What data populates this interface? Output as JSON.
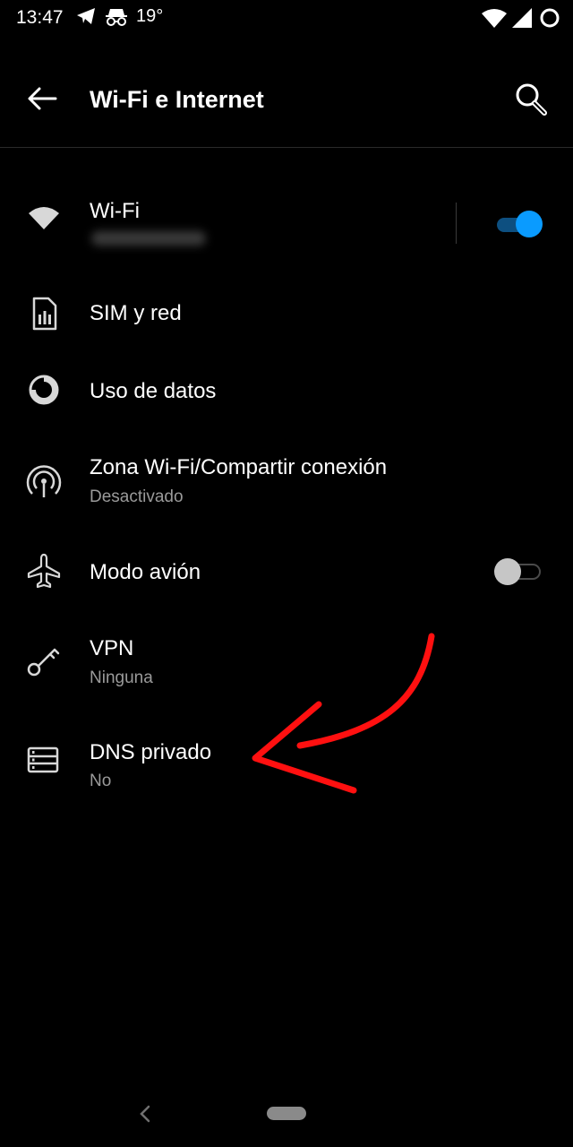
{
  "status_bar": {
    "time": "13:47",
    "temperature": "19°",
    "icons": [
      "telegram-icon",
      "incognito-icon",
      "wifi-icon",
      "signal-icon",
      "battery-icon"
    ]
  },
  "app_bar": {
    "title": "Wi-Fi e Internet",
    "back_icon": "arrow-left-icon",
    "search_icon": "search-icon"
  },
  "settings": [
    {
      "icon": "wifi-icon",
      "label": "Wi-Fi",
      "toggle": "on"
    },
    {
      "icon": "sim-card-icon",
      "label": "SIM y red"
    },
    {
      "icon": "data-usage-icon",
      "label": "Uso de datos"
    },
    {
      "icon": "hotspot-icon",
      "label": "Zona Wi-Fi/Compartir conexión",
      "subtitle": "Desactivado"
    },
    {
      "icon": "airplane-icon",
      "label": "Modo avión",
      "toggle": "off"
    },
    {
      "icon": "vpn-key-icon",
      "label": "VPN",
      "subtitle": "Ninguna"
    },
    {
      "icon": "private-dns-icon",
      "label": "DNS privado",
      "subtitle": "No"
    }
  ],
  "colors": {
    "background": "#000000",
    "accent": "#0a9bff",
    "secondary_text": "#9a9a9a",
    "annotation_arrow": "#ff1010"
  },
  "navigation": {
    "back_icon": "nav-back-icon",
    "home_icon": "home-pill-icon"
  }
}
